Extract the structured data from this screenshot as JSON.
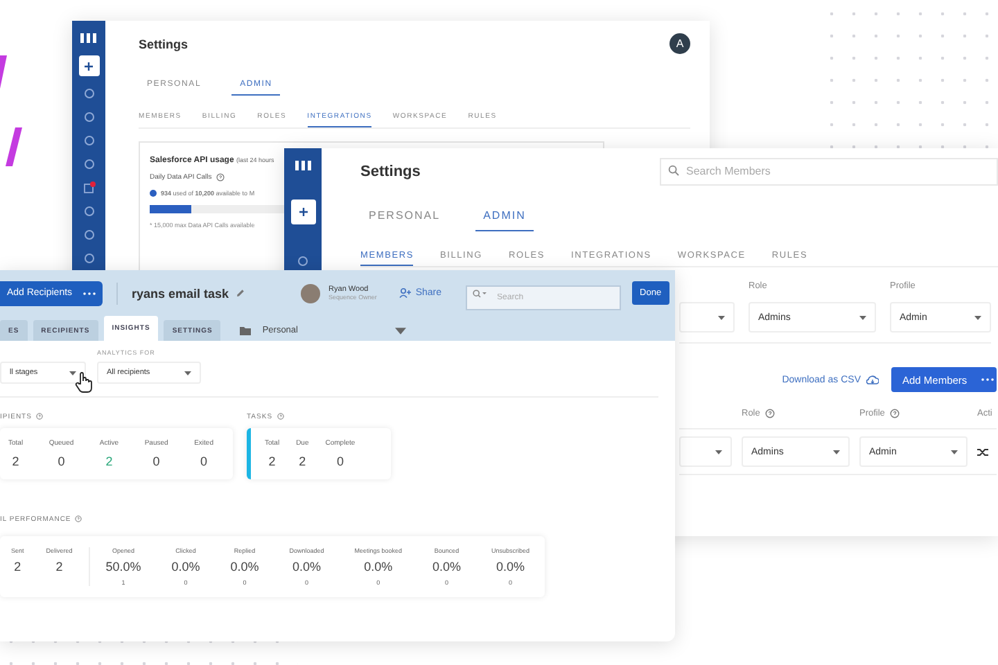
{
  "settings_back": {
    "avatar": "A",
    "title": "Settings",
    "tabs": [
      {
        "label": "PERSONAL",
        "selected": false
      },
      {
        "label": "ADMIN",
        "selected": true
      }
    ],
    "subtabs": [
      {
        "label": "MEMBERS",
        "selected": false
      },
      {
        "label": "BILLING",
        "selected": false
      },
      {
        "label": "ROLES",
        "selected": false
      },
      {
        "label": "INTEGRATIONS",
        "selected": true
      },
      {
        "label": "WORKSPACE",
        "selected": false
      },
      {
        "label": "RULES",
        "selected": false
      }
    ],
    "card": {
      "title": "Salesforce API usage",
      "title_note": "(last 24 hours",
      "metric_label": "Daily Data API Calls",
      "usage": "**934** used of **10,200** available to M",
      "level": 0.27,
      "footnote": "* 15,000 max Data API Calls available"
    }
  },
  "settings_front": {
    "title": "Settings",
    "search_placeholder": "Search Members",
    "tabs": [
      {
        "label": "PERSONAL",
        "selected": false
      },
      {
        "label": "ADMIN",
        "selected": true
      }
    ],
    "subtabs": [
      {
        "label": "MEMBERS",
        "selected": true
      },
      {
        "label": "BILLING",
        "selected": false
      },
      {
        "label": "ROLES",
        "selected": false
      },
      {
        "label": "INTEGRATIONS",
        "selected": false
      },
      {
        "label": "WORKSPACE",
        "selected": false
      },
      {
        "label": "RULES",
        "selected": false
      }
    ],
    "filter_labels": [
      "Role",
      "Profile"
    ],
    "filter_values": {
      "role": "Admins",
      "profile": "Admin"
    },
    "download_link": "Download as CSV",
    "add_button": "Add Members",
    "table": {
      "columns": [
        "Role",
        "Profile",
        "Acti"
      ],
      "rows": [
        {
          "role": "Admins",
          "profile": "Admin"
        }
      ]
    }
  },
  "sequence": {
    "add_button": "Add Recipients",
    "title": "ryans email task",
    "owner": {
      "name": "Ryan Wood",
      "role": "Sequence Owner"
    },
    "share": "Share",
    "search_placeholder": "Search",
    "done": "Done",
    "tabs": [
      {
        "label": "ES",
        "selected": false
      },
      {
        "label": "RECIPIENTS",
        "selected": false
      },
      {
        "label": "INSIGHTS",
        "selected": true
      },
      {
        "label": "SETTINGS",
        "selected": false
      }
    ],
    "folder": "Personal",
    "filters": [
      {
        "value": "ll stages"
      },
      {
        "label": "ANALYTICS FOR",
        "value": "All recipients"
      }
    ],
    "recipients": {
      "title": "IPIENTS",
      "stats": [
        {
          "label": "Total",
          "value": "2",
          "highlighted": false
        },
        {
          "label": "Queued",
          "value": "0",
          "highlighted": false
        },
        {
          "label": "Active",
          "value": "2",
          "highlighted": true
        },
        {
          "label": "Paused",
          "value": "0",
          "highlighted": false
        },
        {
          "label": "Exited",
          "value": "0",
          "highlighted": false
        }
      ]
    },
    "tasks": {
      "title": "TASKS",
      "stats": [
        {
          "label": "Total",
          "value": "2"
        },
        {
          "label": "Due",
          "value": "2"
        },
        {
          "label": "Complete",
          "value": "0"
        }
      ]
    },
    "performance": {
      "title": "IL PERFORMANCE",
      "counts": [
        {
          "label": "Sent",
          "value": "2"
        },
        {
          "label": "Delivered",
          "value": "2"
        }
      ],
      "rates": [
        {
          "label": "Opened",
          "value": "50.0%",
          "count": "1"
        },
        {
          "label": "Clicked",
          "value": "0.0%",
          "count": "0"
        },
        {
          "label": "Replied",
          "value": "0.0%",
          "count": "0"
        },
        {
          "label": "Downloaded",
          "value": "0.0%",
          "count": "0"
        },
        {
          "label": "Meetings booked",
          "value": "0.0%",
          "count": "0"
        },
        {
          "label": "Bounced",
          "value": "0.0%",
          "count": "0"
        },
        {
          "label": "Unsubscribed",
          "value": "0.0%",
          "count": "0"
        }
      ]
    }
  }
}
